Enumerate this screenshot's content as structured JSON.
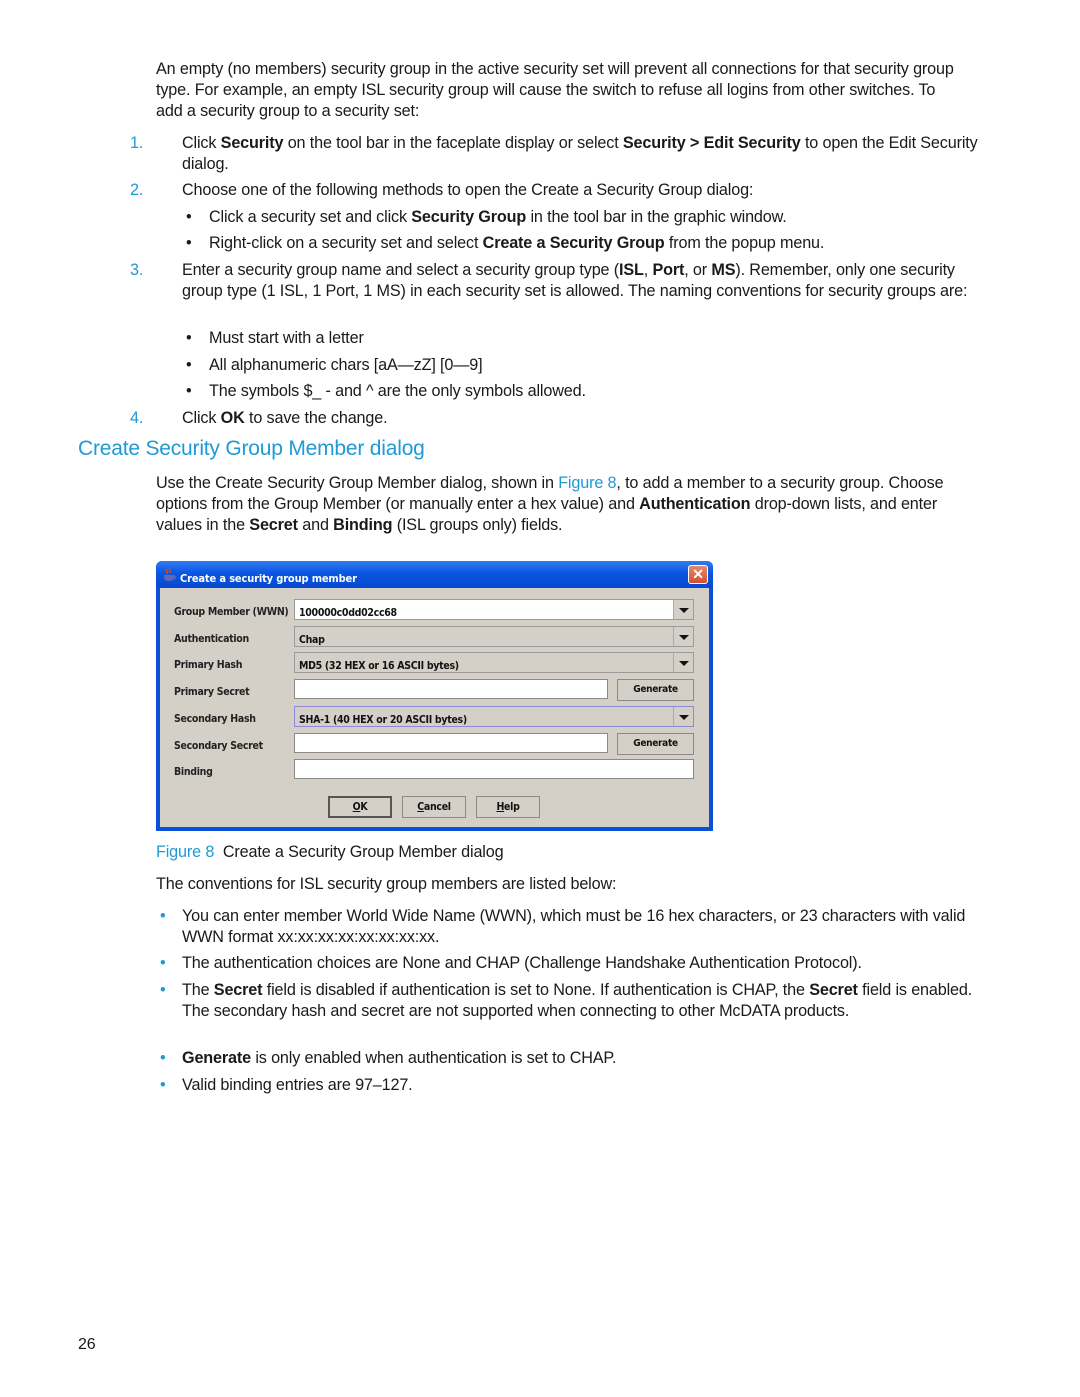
{
  "intro": {
    "paragraph": "An empty (no members) security group in the active security set will prevent all connections for that security group type. For example, an empty ISL security group will cause the switch to refuse all logins from other switches. To add a security group to a security set:"
  },
  "steps": [
    {
      "num": "1.",
      "pre": "Click ",
      "b1": "Security",
      "mid": " on the tool bar in the faceplate display or select ",
      "b2": "Security > Edit Security",
      "post": " to open the Edit Security dialog."
    },
    {
      "num": "2.",
      "text": "Choose one of the following methods to open the Create a Security Group dialog:"
    },
    {
      "num": "3.",
      "pre": "Enter a security group name and select a security group type (",
      "b1": "ISL",
      "sep1": ", ",
      "b2": "Port",
      "sep2": ", or ",
      "b3": "MS",
      "post": "). Remember, only one security group type (1 ISL, 1 Port, 1 MS) in each security set is allowed. The naming conventions for security groups are:"
    },
    {
      "num": "4.",
      "pre": "Click ",
      "b1": "OK",
      "post": " to save the change."
    }
  ],
  "step2_bullets": [
    {
      "pre": "Click a security set and click ",
      "b": "Security Group",
      "post": " in the tool bar in the graphic window."
    },
    {
      "pre": "Right-click on a security set and select ",
      "b": "Create a Security Group",
      "post": " from the popup menu."
    }
  ],
  "step3_bullets": [
    "Must start with a letter",
    "All alphanumeric chars [aA—zZ] [0—9]",
    "The symbols $_ - and ^ are the only symbols allowed."
  ],
  "bullet_char": "•",
  "section": {
    "heading": "Create Security Group Member dialog",
    "p_pre": "Use the Create Security Group Member dialog, shown in ",
    "p_link": "Figure 8",
    "p_mid1": ", to add a member to a security group. Choose options from the Group Member (or manually enter a hex value) and ",
    "p_b1": "Authentication",
    "p_mid2": " drop-down lists, and enter values in the ",
    "p_b2": "Secret",
    "p_mid3": " and ",
    "p_b3": "Binding",
    "p_post": " (ISL groups only) fields."
  },
  "dialog": {
    "title": "Create a security group member",
    "close_glyph": "✕",
    "labels": {
      "group_member": "Group Member (WWN)",
      "authentication": "Authentication",
      "primary_hash": "Primary Hash",
      "primary_secret": "Primary Secret",
      "secondary_hash": "Secondary Hash",
      "secondary_secret": "Secondary Secret",
      "binding": "Binding"
    },
    "values": {
      "group_member": "100000c0dd02cc68",
      "authentication": "Chap",
      "primary_hash": "MD5 (32 HEX or 16 ASCII bytes)",
      "primary_secret": "",
      "secondary_hash": "SHA-1 (40 HEX or 20 ASCII bytes)",
      "secondary_secret": "",
      "binding": ""
    },
    "generate_label": "Generate",
    "ok": {
      "mnemonic": "O",
      "rest": "K"
    },
    "cancel": {
      "mnemonic": "C",
      "rest": "ancel"
    },
    "help": {
      "mnemonic": "H",
      "rest": "elp"
    }
  },
  "figure": {
    "label": "Figure 8",
    "caption": "Create a Security Group Member dialog"
  },
  "conventions": {
    "intro": "The conventions for ISL security group members are listed below:",
    "items": [
      {
        "text": "You can enter member World Wide Name (WWN), which must be 16 hex characters, or 23 characters with valid WWN format xx:xx:xx:xx:xx:xx:xx:xx."
      },
      {
        "text": "The authentication choices are None and CHAP (Challenge Handshake Authentication Protocol)."
      },
      {
        "p1": "The ",
        "b1": "Secret",
        "p2": " field is disabled if authentication is set to None. If authentication is CHAP, the ",
        "b2": "Secret",
        "p3": " field is enabled. The secondary hash and secret are not supported when connecting to other McDATA products."
      },
      {
        "b1": "Generate",
        "p1": " is only enabled when authentication is set to CHAP."
      },
      {
        "text": "Valid binding entries are 97–127."
      }
    ]
  },
  "page_number": "26"
}
